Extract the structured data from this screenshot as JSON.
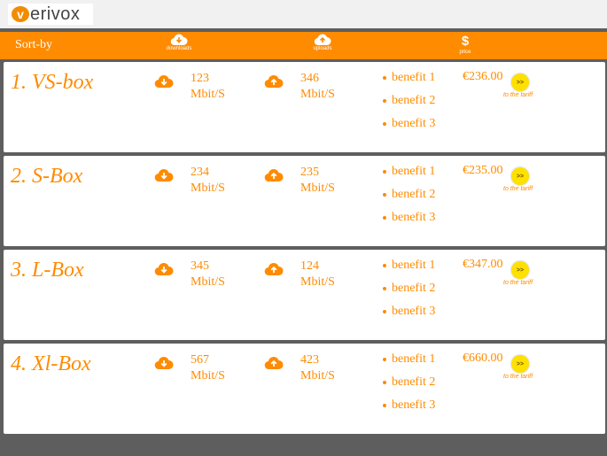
{
  "brand": {
    "logo_letter": "v",
    "logo_text": "erivox"
  },
  "colors": {
    "accent": "#ff8b00",
    "button": "#ffe100",
    "background": "#5e5e5e"
  },
  "sortbar": {
    "label": "Sort-by",
    "downloads": {
      "icon": "cloud-download-icon",
      "caption": "downloads"
    },
    "uploads": {
      "icon": "cloud-upload-icon",
      "caption": "uploads"
    },
    "price": {
      "icon": "dollar-icon",
      "symbol": "$",
      "caption": "price"
    }
  },
  "tariffs": [
    {
      "title": "1. VS-box",
      "download_value": "123",
      "upload_value": "346",
      "unit": "Mbit/S",
      "benefits": [
        "benefit 1",
        "benefit 2",
        "benefit 3"
      ],
      "price": "€236.00",
      "go_label": ">>",
      "link": "to the tariff"
    },
    {
      "title": "2. S-Box",
      "download_value": "234",
      "upload_value": "235",
      "unit": "Mbit/S",
      "benefits": [
        "benefit 1",
        "benefit 2",
        "benefit 3"
      ],
      "price": "€235.00",
      "go_label": ">>",
      "link": "to the tariff"
    },
    {
      "title": "3. L-Box",
      "download_value": "345",
      "upload_value": "124",
      "unit": "Mbit/S",
      "benefits": [
        "benefit 1",
        "benefit 2",
        "benefit 3"
      ],
      "price": "€347.00",
      "go_label": ">>",
      "link": "to the tariff"
    },
    {
      "title": "4. Xl-Box",
      "download_value": "567",
      "upload_value": "423",
      "unit": "Mbit/S",
      "benefits": [
        "benefit 1",
        "benefit 2",
        "benefit 3"
      ],
      "price": "€660.00",
      "go_label": ">>",
      "link": "to the tariff"
    }
  ]
}
